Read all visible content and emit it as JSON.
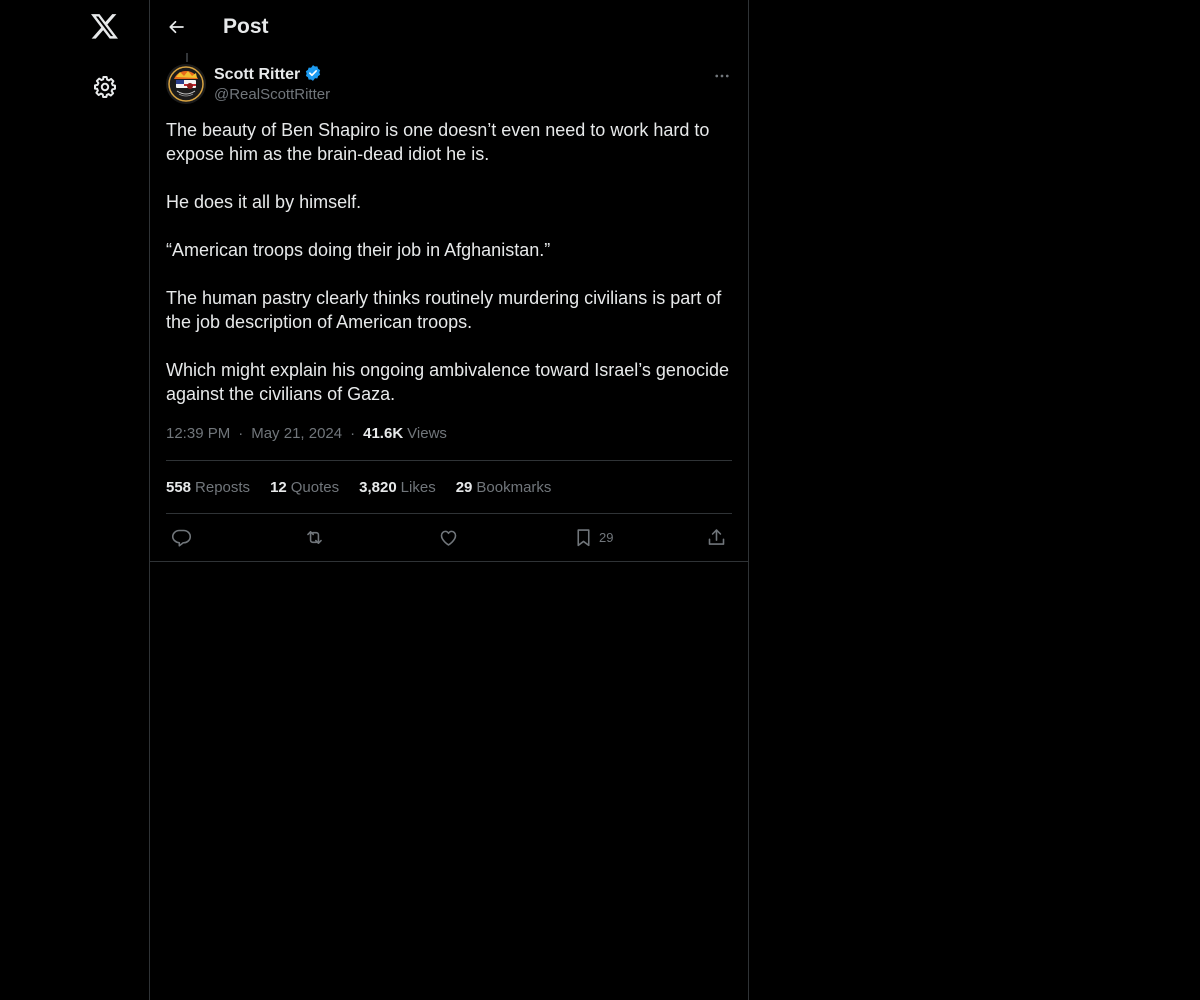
{
  "header": {
    "title": "Post"
  },
  "post": {
    "author": {
      "name": "Scott Ritter",
      "handle": "@RealScottRitter",
      "verified": true
    },
    "paragraphs": [
      "The beauty of Ben Shapiro is one doesn’t even need to work hard to expose him as the brain-dead idiot he is.",
      "He does it all by himself.",
      "“American troops doing their job in Afghanistan.”",
      "The human pastry clearly thinks routinely murdering civilians is part of the job description of American troops.",
      "Which might explain his ongoing ambivalence toward Israel’s genocide against the civilians of Gaza."
    ],
    "time": "12:39 PM",
    "date": "May 21, 2024",
    "separator": "·",
    "views_count": "41.6K",
    "views_label": "Views",
    "stats": {
      "reposts_count": "558",
      "reposts_label": "Reposts",
      "quotes_count": "12",
      "quotes_label": "Quotes",
      "likes_count": "3,820",
      "likes_label": "Likes",
      "bookmarks_count": "29",
      "bookmarks_label": "Bookmarks"
    },
    "actions": {
      "bookmark_count": "29"
    }
  },
  "icons": {
    "logo": "x-logo-icon",
    "settings": "gear-icon",
    "back": "arrow-left-icon",
    "verified": "verified-badge-icon",
    "more": "more-dots-icon",
    "reply": "reply-icon",
    "repost": "repost-icon",
    "like": "heart-icon",
    "bookmark": "bookmark-icon",
    "share": "share-icon"
  },
  "colors": {
    "background": "#000000",
    "text_primary": "#e7e9ea",
    "text_secondary": "#71767b",
    "border": "#2f3336",
    "verified_blue": "#1d9bf0"
  }
}
